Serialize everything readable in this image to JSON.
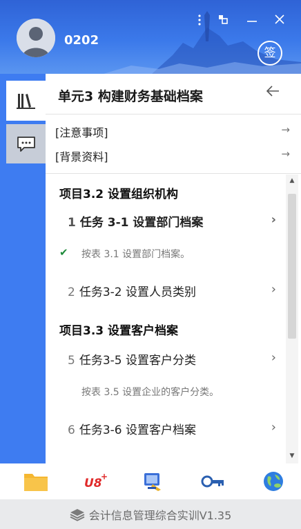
{
  "header": {
    "username": "0202",
    "menu_icon": "more-vertical-icon",
    "restore_icon": "restore-icon",
    "minimize_icon": "minimize-icon",
    "close_icon": "close-icon",
    "sign_label": "签"
  },
  "sidebar": {
    "tabs": [
      {
        "icon": "library-icon",
        "active": true
      },
      {
        "icon": "chat-icon",
        "active": false
      }
    ]
  },
  "main": {
    "unit_title": "单元3 构建财务基础档案",
    "back_icon": "back-arrow-icon",
    "links": [
      {
        "label": "[注意事项]",
        "arrow": "→"
      },
      {
        "label": "[背景资料]",
        "arrow": "→"
      }
    ],
    "projects": [
      {
        "title": "项目3.2 设置组织机构",
        "tasks": [
          {
            "num": "1",
            "label": "任务 3-1 设置部门档案",
            "chevron": "›",
            "check": "✔",
            "note": "按表 3.1 设置部门档案。"
          },
          {
            "num": "2",
            "label": "任务3-2 设置人员类别",
            "chevron": "›"
          }
        ]
      },
      {
        "title": "项目3.3 设置客户档案",
        "tasks": [
          {
            "num": "5",
            "label": "任务3-5 设置客户分类",
            "chevron": "›",
            "note": "按表 3.5 设置企业的客户分类。"
          },
          {
            "num": "6",
            "label": "任务3-6 设置客户档案",
            "chevron": "›"
          }
        ]
      }
    ]
  },
  "toolbar": {
    "items": [
      {
        "icon": "folder-icon",
        "color": "#f5b731"
      },
      {
        "icon": "u8-plus-icon",
        "label": "U8",
        "sup": "+",
        "color": "#e02a2a"
      },
      {
        "icon": "finance-tool-icon",
        "color": "#3a6fd8"
      },
      {
        "icon": "key-icon",
        "color": "#2a5fb0"
      },
      {
        "icon": "globe-icon",
        "color": "#2e7de0"
      }
    ]
  },
  "footer": {
    "icon": "layers-icon",
    "text": "会计信息管理综合实训V1.35"
  },
  "colors": {
    "header_blue": "#3b79ea",
    "sidebar_blue": "#3e7cf1",
    "check_green": "#1e8a3a"
  }
}
